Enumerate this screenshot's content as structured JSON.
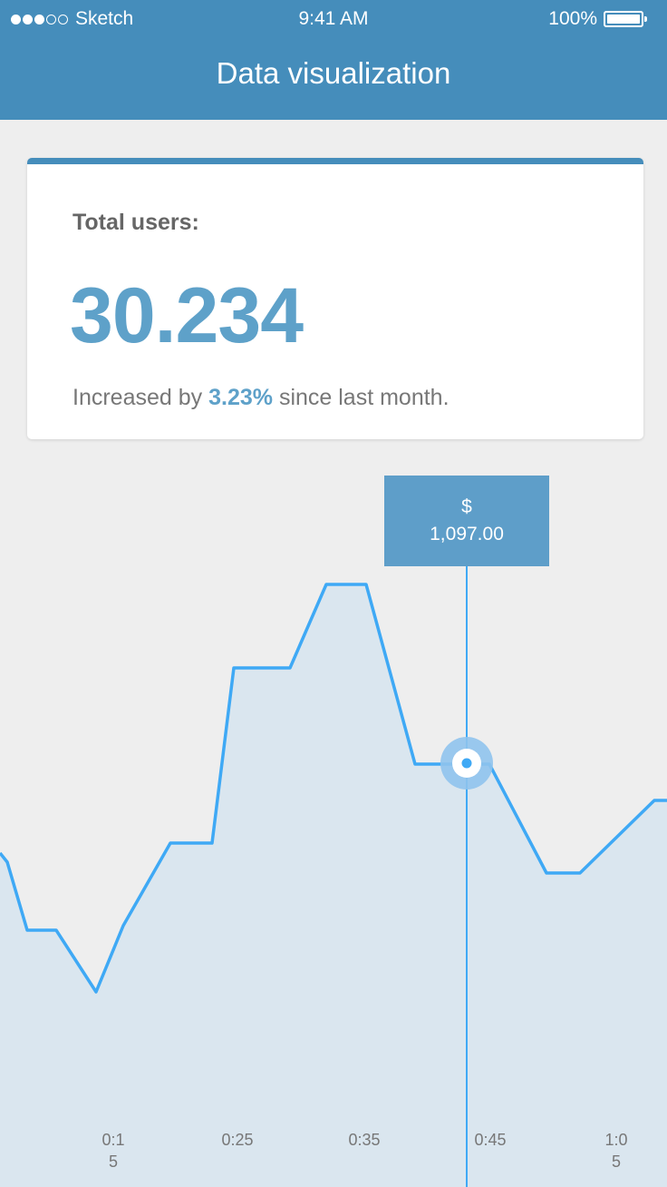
{
  "status_bar": {
    "carrier": "Sketch",
    "time": "9:41 AM",
    "battery": "100%"
  },
  "header": {
    "title": "Data visualization"
  },
  "card": {
    "label": "Total users:",
    "value": "30.234",
    "change_prefix": "Increased by",
    "change_pct": "3.23%",
    "change_suffix": "since last month."
  },
  "tooltip": {
    "currency": "$",
    "value": "1,097.00"
  },
  "chart_data": {
    "type": "area",
    "x_tick_labels": [
      [
        "0:1",
        "5"
      ],
      [
        "0:25"
      ],
      [
        "0:35"
      ],
      [
        "0:45"
      ],
      [
        "1:0",
        "5"
      ]
    ],
    "highlighted_value": "$ 1,097.00",
    "colors": {
      "line": "#3fa9f5",
      "fill": "#dae6ef",
      "marker": "#3fa9f5"
    }
  }
}
